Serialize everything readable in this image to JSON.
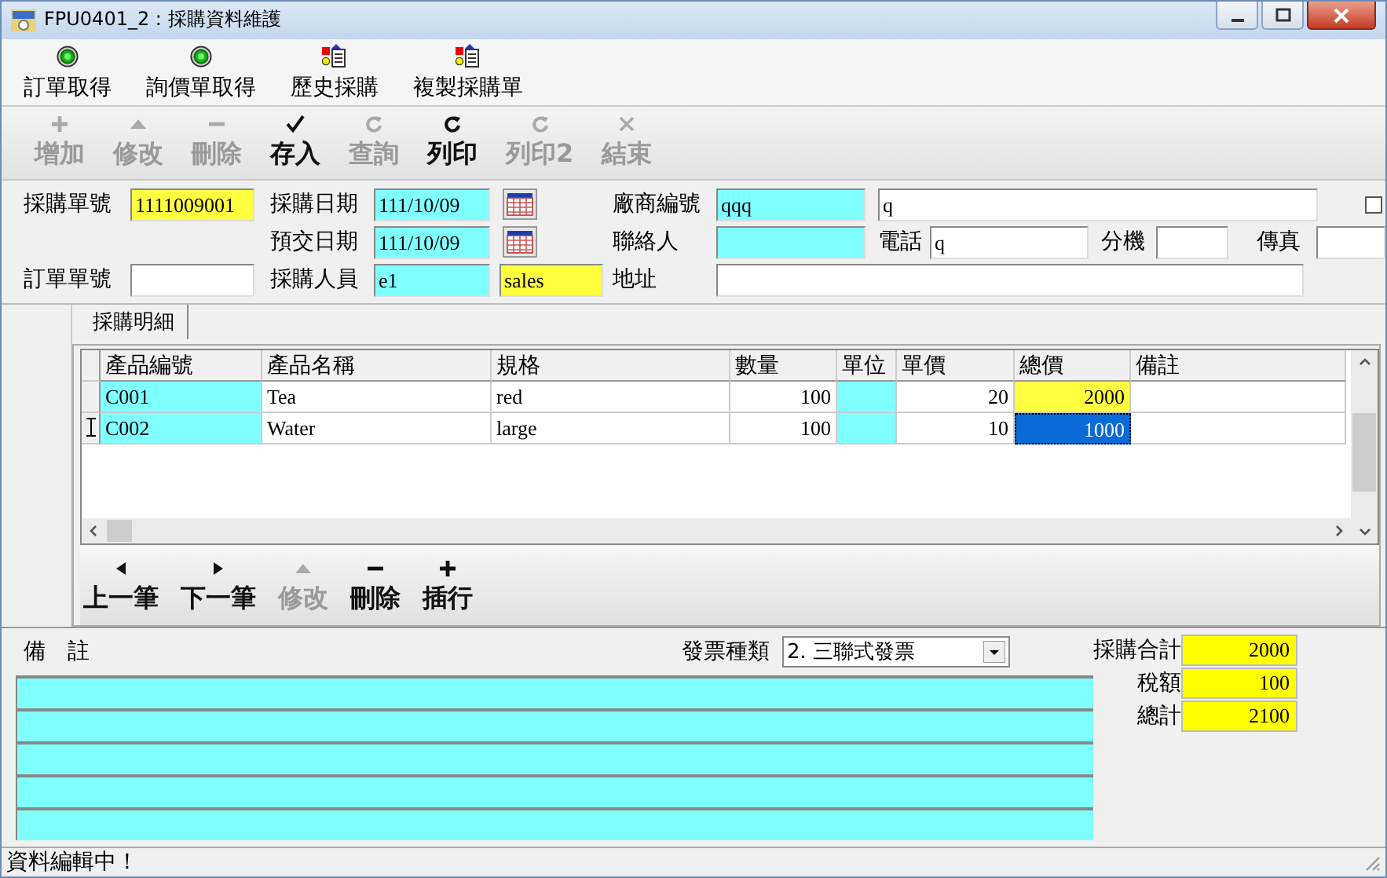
{
  "window": {
    "title": "FPU0401_2 : 採購資料維護"
  },
  "top_toolbar": [
    {
      "label": "訂單取得",
      "kind": "lamp"
    },
    {
      "label": "詢價單取得",
      "kind": "lamp"
    },
    {
      "label": "歷史採購",
      "kind": "doc"
    },
    {
      "label": "複製採購單",
      "kind": "doc"
    }
  ],
  "toolbar": [
    {
      "label": "增加",
      "kind": "add",
      "disabled": true
    },
    {
      "label": "修改",
      "kind": "up",
      "disabled": true
    },
    {
      "label": "刪除",
      "kind": "minus",
      "disabled": true
    },
    {
      "label": "存入",
      "kind": "check",
      "disabled": false
    },
    {
      "label": "查詢",
      "kind": "redo",
      "disabled": true
    },
    {
      "label": "列印",
      "kind": "redo",
      "disabled": false
    },
    {
      "label": "列印2",
      "kind": "redo",
      "disabled": true
    },
    {
      "label": "結束",
      "kind": "close",
      "disabled": true
    }
  ],
  "header": {
    "order_no": {
      "label": "採購單號",
      "value": "1111009001"
    },
    "purchase_date": {
      "label": "採購日期",
      "value": "111/10/09"
    },
    "delivery_date": {
      "label": "預交日期",
      "value": "111/10/09"
    },
    "source_order": {
      "label": "訂單單號"
    },
    "buyer": {
      "label": "採購人員",
      "value": "e1",
      "name": "sales"
    },
    "vendor": {
      "label": "廠商編號",
      "code": "qqq",
      "name": "q",
      "checked": false
    },
    "contact": {
      "label": "聯絡人"
    },
    "phone": {
      "label": "電話",
      "value": "q"
    },
    "extension": {
      "label": "分機"
    },
    "fax": {
      "label": "傳真"
    },
    "address": {
      "label": "地址"
    }
  },
  "detail": {
    "tab": "採購明細",
    "columns": [
      "產品編號",
      "產品名稱",
      "規格",
      "數量",
      "單位",
      "單價",
      "總價",
      "備註"
    ],
    "rows": [
      {
        "selected": false,
        "cells": [
          "C001",
          "Tea",
          "red",
          "100",
          "",
          "20",
          "2000",
          ""
        ]
      },
      {
        "selected": true,
        "cells": [
          "C002",
          "Water",
          "large",
          "100",
          "",
          "10",
          "1000",
          ""
        ]
      }
    ],
    "nav": [
      {
        "label": "上一筆",
        "kind": "left",
        "disabled": false
      },
      {
        "label": "下一筆",
        "kind": "right",
        "disabled": false
      },
      {
        "label": "修改",
        "kind": "up",
        "disabled": true
      },
      {
        "label": "刪除",
        "kind": "minus",
        "disabled": false
      },
      {
        "label": "插行",
        "kind": "add",
        "disabled": false
      }
    ]
  },
  "footer": {
    "remarks_label": "備　註",
    "invoice": {
      "label": "發票種類",
      "value": "2. 三聯式發票"
    },
    "totals": [
      {
        "label": "採購合計",
        "value": "2000"
      },
      {
        "label": "稅額",
        "value": "100"
      },
      {
        "label": "總計",
        "value": "2100"
      }
    ]
  },
  "status_bar": "資料編輯中！"
}
